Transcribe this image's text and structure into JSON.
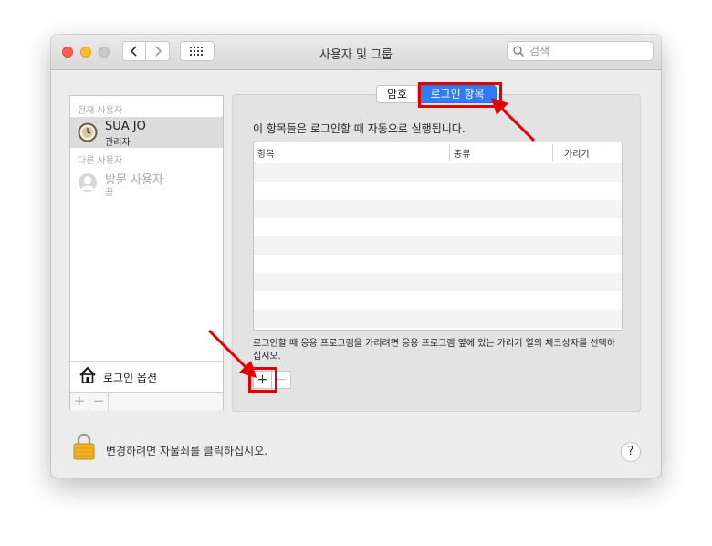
{
  "window": {
    "title": "사용자 및 그룹",
    "search_placeholder": "검색"
  },
  "sidebar": {
    "current_user_label": "현재 사용자",
    "current_user": {
      "name": "SUA JO",
      "role": "관리자"
    },
    "other_users_label": "다른 사용자",
    "other_user": {
      "name": "방문 사용자",
      "status": "끔"
    },
    "login_options_label": "로그인 옵션",
    "add_label": "+",
    "remove_label": "−"
  },
  "panel": {
    "tabs": [
      {
        "label": "암호",
        "selected": false
      },
      {
        "label": "로그인 항목",
        "selected": true
      }
    ],
    "intro_text": "이 항목들은 로그인할 때 자동으로 실행됩니다.",
    "table": {
      "columns": [
        "항목",
        "종류",
        "가리기"
      ],
      "rows": []
    },
    "hint_text": "로그인할 때 응용 프로그램을 가리려면 응용 프로그램 옆에 있는 가리기 열의 체크상자를 선택하십시오.",
    "add_label": "+",
    "remove_label": "−"
  },
  "footer": {
    "lock_text": "변경하려면 자물쇠를 클릭하십시오.",
    "help_label": "?"
  },
  "colors": {
    "accent": "#2f7df6",
    "annotation": "#e30000",
    "window_bg": "#ececec"
  }
}
